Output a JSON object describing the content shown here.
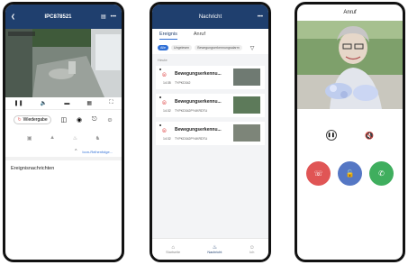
{
  "phone1": {
    "title": "IPC878521",
    "playback_label": "Wiedergabe",
    "sort_label": "Icon-Reihenfolge...",
    "events_heading": "Ereignisnachrichten"
  },
  "phone2": {
    "title": "Nachricht",
    "tabs": [
      "Ereignis",
      "Anruf"
    ],
    "chips": [
      "Alle",
      "Ungelesen",
      "Bewegungserkennungsalarm"
    ],
    "date": "Heute",
    "items": [
      {
        "title": "Bewegungserkennu...",
        "time": "14:35",
        "sub": "TYPKD342"
      },
      {
        "title": "Bewegungserkennu...",
        "time": "14:32",
        "sub": "TYPKD342PY4KRDTU"
      },
      {
        "title": "Bewegungserkennu...",
        "time": "14:32",
        "sub": "TYPKD342PY4KRDTU"
      }
    ],
    "nav": [
      "Startseite",
      "Nachricht",
      "Ich"
    ]
  },
  "phone3": {
    "title": "Anruf"
  },
  "colors": {
    "header_blue": "#1f3f6e",
    "accent": "#2f6fd6",
    "red": "#e05555",
    "blue": "#5577c4",
    "green": "#3fae5e"
  }
}
